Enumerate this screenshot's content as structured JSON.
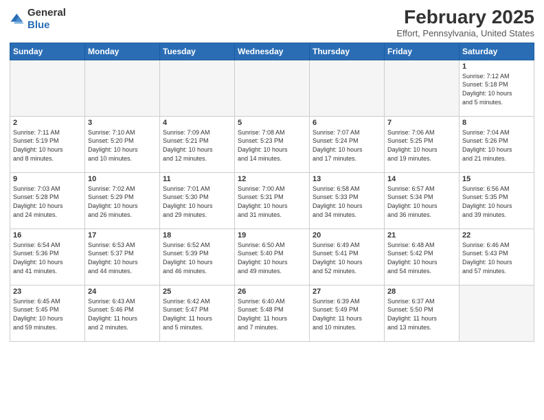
{
  "header": {
    "logo_general": "General",
    "logo_blue": "Blue",
    "month_title": "February 2025",
    "location": "Effort, Pennsylvania, United States"
  },
  "weekdays": [
    "Sunday",
    "Monday",
    "Tuesday",
    "Wednesday",
    "Thursday",
    "Friday",
    "Saturday"
  ],
  "weeks": [
    [
      {
        "day": "",
        "info": ""
      },
      {
        "day": "",
        "info": ""
      },
      {
        "day": "",
        "info": ""
      },
      {
        "day": "",
        "info": ""
      },
      {
        "day": "",
        "info": ""
      },
      {
        "day": "",
        "info": ""
      },
      {
        "day": "1",
        "info": "Sunrise: 7:12 AM\nSunset: 5:18 PM\nDaylight: 10 hours\nand 5 minutes."
      }
    ],
    [
      {
        "day": "2",
        "info": "Sunrise: 7:11 AM\nSunset: 5:19 PM\nDaylight: 10 hours\nand 8 minutes."
      },
      {
        "day": "3",
        "info": "Sunrise: 7:10 AM\nSunset: 5:20 PM\nDaylight: 10 hours\nand 10 minutes."
      },
      {
        "day": "4",
        "info": "Sunrise: 7:09 AM\nSunset: 5:21 PM\nDaylight: 10 hours\nand 12 minutes."
      },
      {
        "day": "5",
        "info": "Sunrise: 7:08 AM\nSunset: 5:23 PM\nDaylight: 10 hours\nand 14 minutes."
      },
      {
        "day": "6",
        "info": "Sunrise: 7:07 AM\nSunset: 5:24 PM\nDaylight: 10 hours\nand 17 minutes."
      },
      {
        "day": "7",
        "info": "Sunrise: 7:06 AM\nSunset: 5:25 PM\nDaylight: 10 hours\nand 19 minutes."
      },
      {
        "day": "8",
        "info": "Sunrise: 7:04 AM\nSunset: 5:26 PM\nDaylight: 10 hours\nand 21 minutes."
      }
    ],
    [
      {
        "day": "9",
        "info": "Sunrise: 7:03 AM\nSunset: 5:28 PM\nDaylight: 10 hours\nand 24 minutes."
      },
      {
        "day": "10",
        "info": "Sunrise: 7:02 AM\nSunset: 5:29 PM\nDaylight: 10 hours\nand 26 minutes."
      },
      {
        "day": "11",
        "info": "Sunrise: 7:01 AM\nSunset: 5:30 PM\nDaylight: 10 hours\nand 29 minutes."
      },
      {
        "day": "12",
        "info": "Sunrise: 7:00 AM\nSunset: 5:31 PM\nDaylight: 10 hours\nand 31 minutes."
      },
      {
        "day": "13",
        "info": "Sunrise: 6:58 AM\nSunset: 5:33 PM\nDaylight: 10 hours\nand 34 minutes."
      },
      {
        "day": "14",
        "info": "Sunrise: 6:57 AM\nSunset: 5:34 PM\nDaylight: 10 hours\nand 36 minutes."
      },
      {
        "day": "15",
        "info": "Sunrise: 6:56 AM\nSunset: 5:35 PM\nDaylight: 10 hours\nand 39 minutes."
      }
    ],
    [
      {
        "day": "16",
        "info": "Sunrise: 6:54 AM\nSunset: 5:36 PM\nDaylight: 10 hours\nand 41 minutes."
      },
      {
        "day": "17",
        "info": "Sunrise: 6:53 AM\nSunset: 5:37 PM\nDaylight: 10 hours\nand 44 minutes."
      },
      {
        "day": "18",
        "info": "Sunrise: 6:52 AM\nSunset: 5:39 PM\nDaylight: 10 hours\nand 46 minutes."
      },
      {
        "day": "19",
        "info": "Sunrise: 6:50 AM\nSunset: 5:40 PM\nDaylight: 10 hours\nand 49 minutes."
      },
      {
        "day": "20",
        "info": "Sunrise: 6:49 AM\nSunset: 5:41 PM\nDaylight: 10 hours\nand 52 minutes."
      },
      {
        "day": "21",
        "info": "Sunrise: 6:48 AM\nSunset: 5:42 PM\nDaylight: 10 hours\nand 54 minutes."
      },
      {
        "day": "22",
        "info": "Sunrise: 6:46 AM\nSunset: 5:43 PM\nDaylight: 10 hours\nand 57 minutes."
      }
    ],
    [
      {
        "day": "23",
        "info": "Sunrise: 6:45 AM\nSunset: 5:45 PM\nDaylight: 10 hours\nand 59 minutes."
      },
      {
        "day": "24",
        "info": "Sunrise: 6:43 AM\nSunset: 5:46 PM\nDaylight: 11 hours\nand 2 minutes."
      },
      {
        "day": "25",
        "info": "Sunrise: 6:42 AM\nSunset: 5:47 PM\nDaylight: 11 hours\nand 5 minutes."
      },
      {
        "day": "26",
        "info": "Sunrise: 6:40 AM\nSunset: 5:48 PM\nDaylight: 11 hours\nand 7 minutes."
      },
      {
        "day": "27",
        "info": "Sunrise: 6:39 AM\nSunset: 5:49 PM\nDaylight: 11 hours\nand 10 minutes."
      },
      {
        "day": "28",
        "info": "Sunrise: 6:37 AM\nSunset: 5:50 PM\nDaylight: 11 hours\nand 13 minutes."
      },
      {
        "day": "",
        "info": ""
      }
    ]
  ]
}
